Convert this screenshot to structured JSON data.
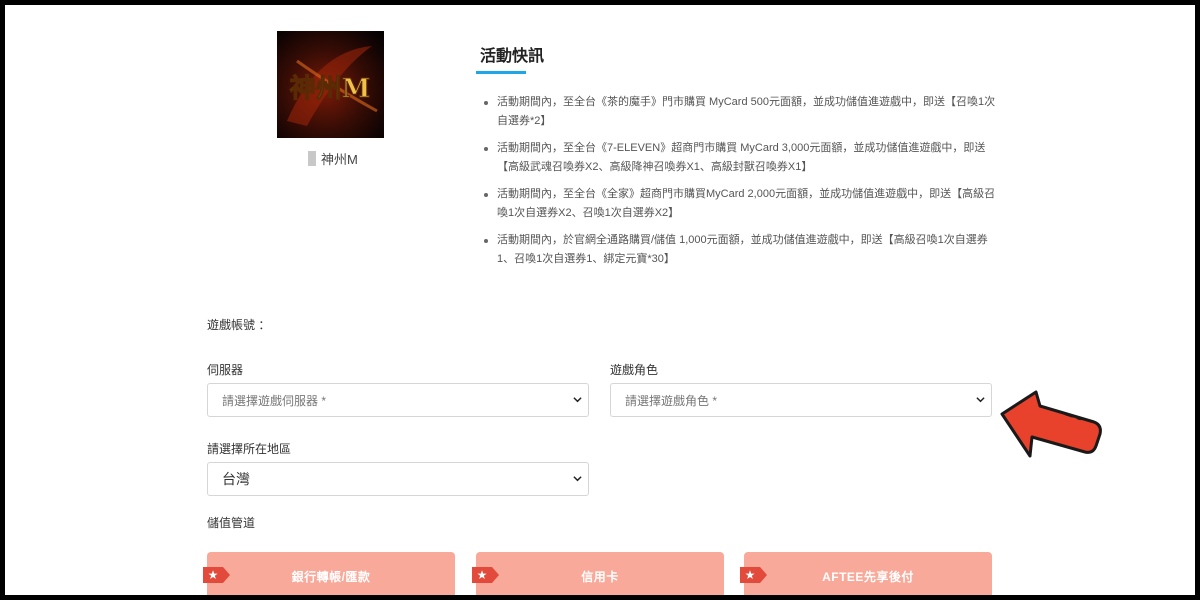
{
  "game": {
    "logo_text": "神州M",
    "name": "神州M"
  },
  "news": {
    "title": "活動快訊",
    "items": [
      "活動期間內，至全台《茶的魔手》門市購買 MyCard 500元面額，並成功儲值進遊戲中，即送【召喚1次自選券*2】",
      "活動期間內，至全台《7-ELEVEN》超商門市購買 MyCard 3,000元面額，並成功儲值進遊戲中，即送【高級武魂召喚券X2、高級降神召喚券X1、高級封獸召喚券X1】",
      "活動期間內，至全台《全家》超商門市購買MyCard 2,000元面額，並成功儲值進遊戲中，即送【高級召喚1次自選券X2、召喚1次自選券X2】",
      "活動期間內，於官網全通路購買/儲值 1,000元面額，並成功儲值進遊戲中，即送【高級召喚1次自選券1、召喚1次自選券1、綁定元寶*30】"
    ]
  },
  "form": {
    "account_label": "遊戲帳號 ：",
    "server_label": "伺服器",
    "server_placeholder": "請選擇遊戲伺服器 *",
    "role_label": "遊戲角色",
    "role_placeholder": "請選擇遊戲角色 *",
    "region_label": "請選擇所在地區",
    "region_value": "台灣",
    "channel_label": "儲值管道"
  },
  "payments": [
    {
      "label": "銀行轉帳/匯款"
    },
    {
      "label": "信用卡"
    },
    {
      "label": "AFTEE先享後付"
    }
  ],
  "colors": {
    "accent": "#1ea7e4",
    "pay_button": "#f8a99a",
    "arrow": "#e8412c"
  },
  "icons": {
    "select_chevron": "chevron-down-icon",
    "pay_tag": "star-tag-icon",
    "pointer": "arrow-pointer-icon"
  }
}
